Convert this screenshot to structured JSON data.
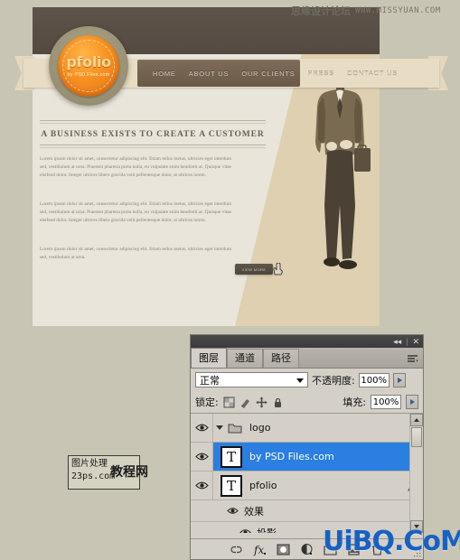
{
  "watermarks": {
    "top_cn": "思缘设计论坛",
    "top_en": "WWW.MISSYUAN.COM",
    "corner": "UiBQ.CoM"
  },
  "stamp": {
    "line1": "图片处理",
    "line2": "23ps.com",
    "overlay": "教程网"
  },
  "website": {
    "logo": {
      "word": "pfolio",
      "sub": "by PSD Files.com"
    },
    "nav": [
      {
        "label": "HOME"
      },
      {
        "label": "ABOUT US"
      },
      {
        "label": "OUR CLIENTS"
      },
      {
        "label": "PRESS"
      },
      {
        "label": "CONTACT US"
      }
    ],
    "headline": "A BUSINESS EXISTS TO CREATE A CUSTOMER",
    "paragraphs": [
      "Lorem ipsum dolor sit amet, consectetur adipiscing elit. Etiam tellus metus, ultricies eget interdum sed, vestibulum at urna. Praesent pharetra porta nulla, eu vulputate enim hendrerit at. Quisque vitae eleifend dolor. Integer ultrices libero gravida velit pellentesque dolor, at ultrices lorem.",
      "Lorem ipsum dolor sit amet, consectetur adipiscing elit. Etiam tellus metus, ultricies eget interdum sed, vestibulum at urna. Praesent pharetra porta nulla, eu vulputate enim hendrerit at. Quisque vitae eleifend dolor. Integer ultrices libero gravida velit pellentesque dolor, at ultrices lorem.",
      "Lorem ipsum dolor sit amet, consectetur adipiscing elit. Etiam tellus metus, ultricies eget interdum sed, vestibulum at urna."
    ],
    "cta_label": "VIEW MORE"
  },
  "panel": {
    "titlebar": {
      "collapse": "◂◂",
      "separator": "|",
      "close": "✕"
    },
    "tabs": [
      {
        "label": "图层",
        "active": true
      },
      {
        "label": "通道",
        "active": false
      },
      {
        "label": "路径",
        "active": false
      }
    ],
    "blend_mode": "正常",
    "opacity_label": "不透明度:",
    "opacity_value": "100%",
    "lock_label": "锁定:",
    "fill_label": "填充:",
    "fill_value": "100%",
    "layers": [
      {
        "name": "logo",
        "type": "group",
        "selected": false,
        "has_fx": false
      },
      {
        "name": "by PSD Files.com",
        "type": "text",
        "selected": true,
        "has_fx": false
      },
      {
        "name": "pfolio",
        "type": "text",
        "selected": false,
        "has_fx": true
      }
    ],
    "effects": {
      "group": "效果",
      "item": "投影"
    },
    "colors": {
      "selection": "#2a7fe0",
      "panel_bg": "#d4d0c8",
      "titlebar": "#3c3c3c"
    }
  }
}
